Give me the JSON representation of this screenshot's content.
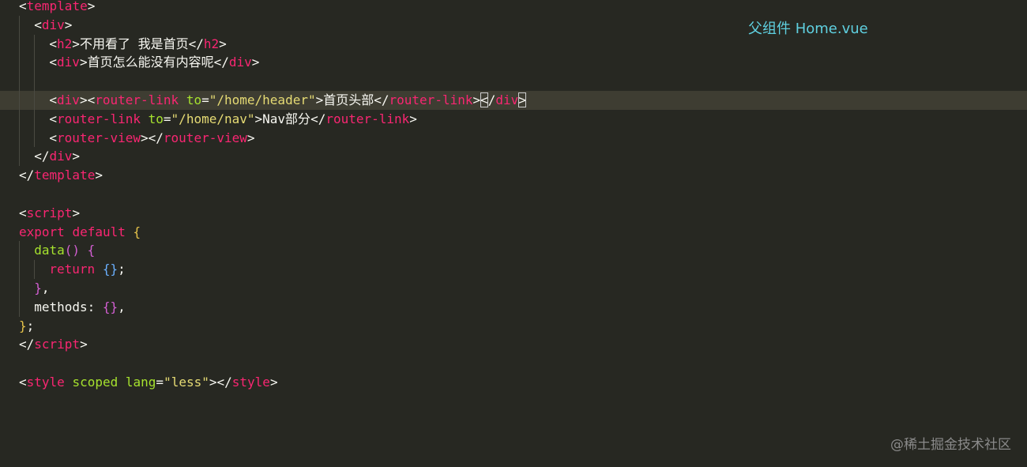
{
  "editor": {
    "language": "vue",
    "theme_colors": {
      "background": "#272822",
      "current_line": "#3e3d32",
      "tag": "#f92672",
      "attribute": "#a6e22e",
      "string": "#e6db74",
      "text": "#f8f8f2",
      "annotation": "#5fd0e0"
    },
    "current_line_index": 5,
    "lines": [
      {
        "indent": 0,
        "tokens": [
          {
            "t": "<",
            "c": "punct"
          },
          {
            "t": "template",
            "c": "tag"
          },
          {
            "t": ">",
            "c": "punct"
          }
        ]
      },
      {
        "indent": 1,
        "tokens": [
          {
            "t": "<",
            "c": "punct"
          },
          {
            "t": "div",
            "c": "tag"
          },
          {
            "t": ">",
            "c": "punct"
          }
        ]
      },
      {
        "indent": 2,
        "tokens": [
          {
            "t": "<",
            "c": "punct"
          },
          {
            "t": "h2",
            "c": "tag"
          },
          {
            "t": ">",
            "c": "punct"
          },
          {
            "t": "不用看了 我是首页",
            "c": "text"
          },
          {
            "t": "</",
            "c": "punct"
          },
          {
            "t": "h2",
            "c": "tag"
          },
          {
            "t": ">",
            "c": "punct"
          }
        ]
      },
      {
        "indent": 2,
        "tokens": [
          {
            "t": "<",
            "c": "punct"
          },
          {
            "t": "div",
            "c": "tag"
          },
          {
            "t": ">",
            "c": "punct"
          },
          {
            "t": "首页怎么能没有内容呢",
            "c": "text"
          },
          {
            "t": "</",
            "c": "punct"
          },
          {
            "t": "div",
            "c": "tag"
          },
          {
            "t": ">",
            "c": "punct"
          }
        ]
      },
      {
        "indent": 2,
        "tokens": []
      },
      {
        "indent": 2,
        "tokens": [
          {
            "t": "<",
            "c": "punct"
          },
          {
            "t": "div",
            "c": "tag"
          },
          {
            "t": ">",
            "c": "punct"
          },
          {
            "t": "<",
            "c": "punct"
          },
          {
            "t": "router-link",
            "c": "tag"
          },
          {
            "t": " ",
            "c": "text"
          },
          {
            "t": "to",
            "c": "attr"
          },
          {
            "t": "=",
            "c": "punct"
          },
          {
            "t": "\"/home/header\"",
            "c": "str"
          },
          {
            "t": ">",
            "c": "punct"
          },
          {
            "t": "首页头部",
            "c": "text"
          },
          {
            "t": "</",
            "c": "punct"
          },
          {
            "t": "router-link",
            "c": "tag"
          },
          {
            "t": ">",
            "c": "punct"
          },
          {
            "t": "<",
            "c": "cursor"
          },
          {
            "t": "/",
            "c": "punct"
          },
          {
            "t": "div",
            "c": "tag"
          },
          {
            "t": ">",
            "c": "cursor"
          }
        ]
      },
      {
        "indent": 2,
        "tokens": [
          {
            "t": "<",
            "c": "punct"
          },
          {
            "t": "router-link",
            "c": "tag"
          },
          {
            "t": " ",
            "c": "text"
          },
          {
            "t": "to",
            "c": "attr"
          },
          {
            "t": "=",
            "c": "punct"
          },
          {
            "t": "\"/home/nav\"",
            "c": "str"
          },
          {
            "t": ">",
            "c": "punct"
          },
          {
            "t": "Nav部分",
            "c": "text"
          },
          {
            "t": "</",
            "c": "punct"
          },
          {
            "t": "router-link",
            "c": "tag"
          },
          {
            "t": ">",
            "c": "punct"
          }
        ]
      },
      {
        "indent": 2,
        "tokens": [
          {
            "t": "<",
            "c": "punct"
          },
          {
            "t": "router-view",
            "c": "tag"
          },
          {
            "t": ">",
            "c": "punct"
          },
          {
            "t": "</",
            "c": "punct"
          },
          {
            "t": "router-view",
            "c": "tag"
          },
          {
            "t": ">",
            "c": "punct"
          }
        ]
      },
      {
        "indent": 1,
        "tokens": [
          {
            "t": "</",
            "c": "punct"
          },
          {
            "t": "div",
            "c": "tag"
          },
          {
            "t": ">",
            "c": "punct"
          }
        ]
      },
      {
        "indent": 0,
        "tokens": [
          {
            "t": "</",
            "c": "punct"
          },
          {
            "t": "template",
            "c": "tag"
          },
          {
            "t": ">",
            "c": "punct"
          }
        ]
      },
      {
        "indent": 0,
        "tokens": []
      },
      {
        "indent": 0,
        "tokens": [
          {
            "t": "<",
            "c": "punct"
          },
          {
            "t": "script",
            "c": "tag"
          },
          {
            "t": ">",
            "c": "punct"
          }
        ]
      },
      {
        "indent": 0,
        "tokens": [
          {
            "t": "export",
            "c": "kw"
          },
          {
            "t": " ",
            "c": "text"
          },
          {
            "t": "default",
            "c": "kw"
          },
          {
            "t": " ",
            "c": "text"
          },
          {
            "t": "{",
            "c": "brace"
          }
        ]
      },
      {
        "indent": 1,
        "tokens": [
          {
            "t": "data",
            "c": "fn"
          },
          {
            "t": "()",
            "c": "brace2"
          },
          {
            "t": " ",
            "c": "text"
          },
          {
            "t": "{",
            "c": "brace2"
          }
        ]
      },
      {
        "indent": 2,
        "tokens": [
          {
            "t": "return",
            "c": "kw"
          },
          {
            "t": " ",
            "c": "text"
          },
          {
            "t": "{}",
            "c": "brace3"
          },
          {
            "t": ";",
            "c": "punct"
          }
        ]
      },
      {
        "indent": 1,
        "tokens": [
          {
            "t": "}",
            "c": "brace2"
          },
          {
            "t": ",",
            "c": "punct"
          }
        ]
      },
      {
        "indent": 1,
        "tokens": [
          {
            "t": "methods",
            "c": "text"
          },
          {
            "t": ": ",
            "c": "punct"
          },
          {
            "t": "{}",
            "c": "brace2"
          },
          {
            "t": ",",
            "c": "punct"
          }
        ]
      },
      {
        "indent": 0,
        "tokens": [
          {
            "t": "}",
            "c": "brace"
          },
          {
            "t": ";",
            "c": "punct"
          }
        ]
      },
      {
        "indent": 0,
        "tokens": [
          {
            "t": "</",
            "c": "punct"
          },
          {
            "t": "script",
            "c": "tag"
          },
          {
            "t": ">",
            "c": "punct"
          }
        ]
      },
      {
        "indent": 0,
        "tokens": []
      },
      {
        "indent": 0,
        "tokens": [
          {
            "t": "<",
            "c": "punct"
          },
          {
            "t": "style",
            "c": "tag"
          },
          {
            "t": " ",
            "c": "text"
          },
          {
            "t": "scoped",
            "c": "attr"
          },
          {
            "t": " ",
            "c": "text"
          },
          {
            "t": "lang",
            "c": "attr"
          },
          {
            "t": "=",
            "c": "punct"
          },
          {
            "t": "\"less\"",
            "c": "str"
          },
          {
            "t": ">",
            "c": "punct"
          },
          {
            "t": "</",
            "c": "punct"
          },
          {
            "t": "style",
            "c": "tag"
          },
          {
            "t": ">",
            "c": "punct"
          }
        ]
      }
    ]
  },
  "annotation": {
    "text": "父组件 Home.vue"
  },
  "watermark": {
    "text": "@稀土掘金技术社区"
  }
}
